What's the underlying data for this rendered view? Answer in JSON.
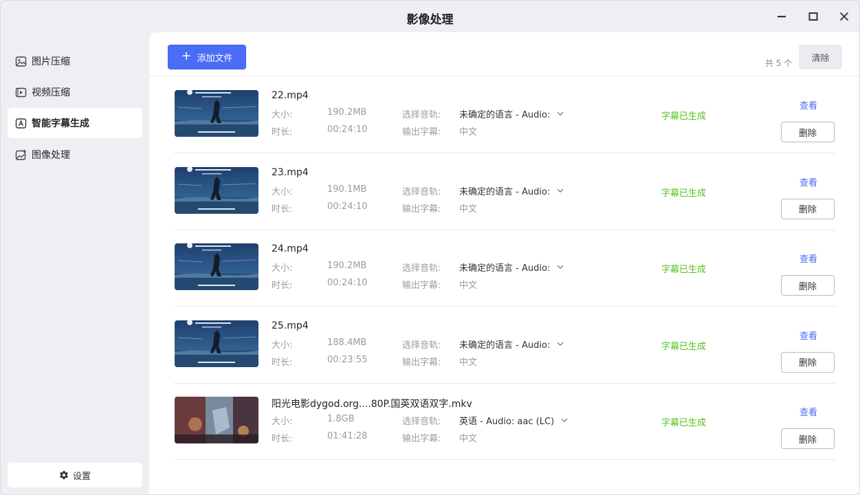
{
  "window": {
    "title": "影像处理"
  },
  "sidebar": {
    "items": [
      {
        "label": "图片压缩",
        "icon": "image-icon",
        "active": false
      },
      {
        "label": "视频压缩",
        "icon": "video-icon",
        "active": false
      },
      {
        "label": "智能字幕生成",
        "icon": "subtitle-icon",
        "active": true
      },
      {
        "label": "图像处理",
        "icon": "image-edit-icon",
        "active": false
      }
    ],
    "settings_label": "设置"
  },
  "toolbar": {
    "add_label": "添加文件",
    "count_text": "共 5 个",
    "clear_label": "清除"
  },
  "labels": {
    "size": "大小:",
    "duration": "时长:",
    "audio_track": "选择音轨:",
    "output_subtitle": "输出字幕:",
    "view": "查看",
    "delete": "删除"
  },
  "files": [
    {
      "name": "22.mp4",
      "size": "190.2MB",
      "duration": "00:24:10",
      "audio": "未确定的语言 - Audio:",
      "subtitle": "中文",
      "status": "字幕已生成"
    },
    {
      "name": "23.mp4",
      "size": "190.1MB",
      "duration": "00:24:10",
      "audio": "未确定的语言 - Audio:",
      "subtitle": "中文",
      "status": "字幕已生成"
    },
    {
      "name": "24.mp4",
      "size": "190.2MB",
      "duration": "00:24:10",
      "audio": "未确定的语言 - Audio:",
      "subtitle": "中文",
      "status": "字幕已生成"
    },
    {
      "name": "25.mp4",
      "size": "188.4MB",
      "duration": "00:23:55",
      "audio": "未确定的语言 - Audio:",
      "subtitle": "中文",
      "status": "字幕已生成"
    },
    {
      "name": "阳光电影dygod.org....80P.国英双语双字.mkv",
      "size": "1.8GB",
      "duration": "01:41:28",
      "audio": "英语 - Audio: aac (LC)",
      "subtitle": "中文",
      "status": "字幕已生成"
    }
  ],
  "colors": {
    "accent": "#4a6cf7",
    "success": "#52c41a",
    "sidebar_bg": "#eeeff3"
  }
}
